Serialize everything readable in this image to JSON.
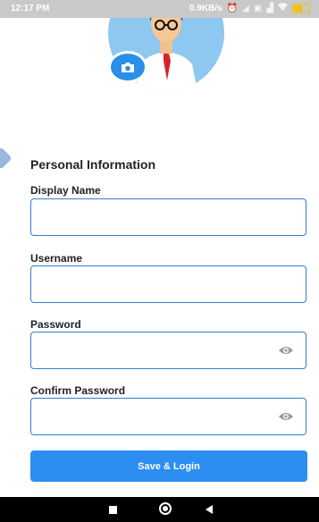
{
  "status_bar": {
    "time": "12:17 PM",
    "net_speed": "0.9KB/s",
    "icons": [
      "alarm-icon",
      "signal-icon",
      "sim-icon",
      "signal-bars-icon",
      "wifi-icon",
      "battery-icon"
    ]
  },
  "profile": {
    "avatar_icon": "avatar-illustration",
    "camera_icon": "camera-icon"
  },
  "form": {
    "section_title": "Personal Information",
    "fields": {
      "display_name": {
        "label": "Display Name",
        "value": ""
      },
      "username": {
        "label": "Username",
        "value": ""
      },
      "password": {
        "label": "Password",
        "value": "",
        "toggle_icon": "eye-icon"
      },
      "confirm_password": {
        "label": "Confirm Password",
        "value": "",
        "toggle_icon": "eye-icon"
      }
    },
    "submit_label": "Save & Login"
  },
  "colors": {
    "accent": "#2b8ef0",
    "field_border": "#2f7fd0",
    "avatar_bg": "#8ec7f0",
    "status_bar": "#c9c9c9",
    "nav_bar": "#000000"
  },
  "nav_bar": {
    "icons": [
      "recents-icon",
      "home-icon",
      "back-icon"
    ]
  }
}
